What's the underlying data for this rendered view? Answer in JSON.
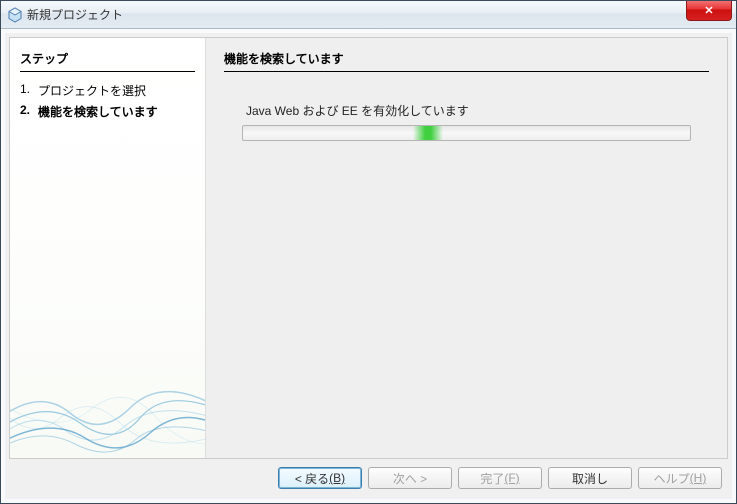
{
  "window": {
    "title": "新規プロジェクト"
  },
  "sidebar": {
    "header": "ステップ",
    "steps": [
      {
        "num": "1.",
        "label": "プロジェクトを選択",
        "current": false
      },
      {
        "num": "2.",
        "label": "機能を検索しています",
        "current": true
      }
    ]
  },
  "main": {
    "header": "機能を検索しています",
    "status": "Java Web および EE を有効化しています"
  },
  "buttons": {
    "back": "< 戻る",
    "back_key": "(B)",
    "next": "次へ >",
    "finish": "完了",
    "finish_key": "(F)",
    "cancel": "取消し",
    "help": "ヘルプ",
    "help_key": "(H)"
  }
}
